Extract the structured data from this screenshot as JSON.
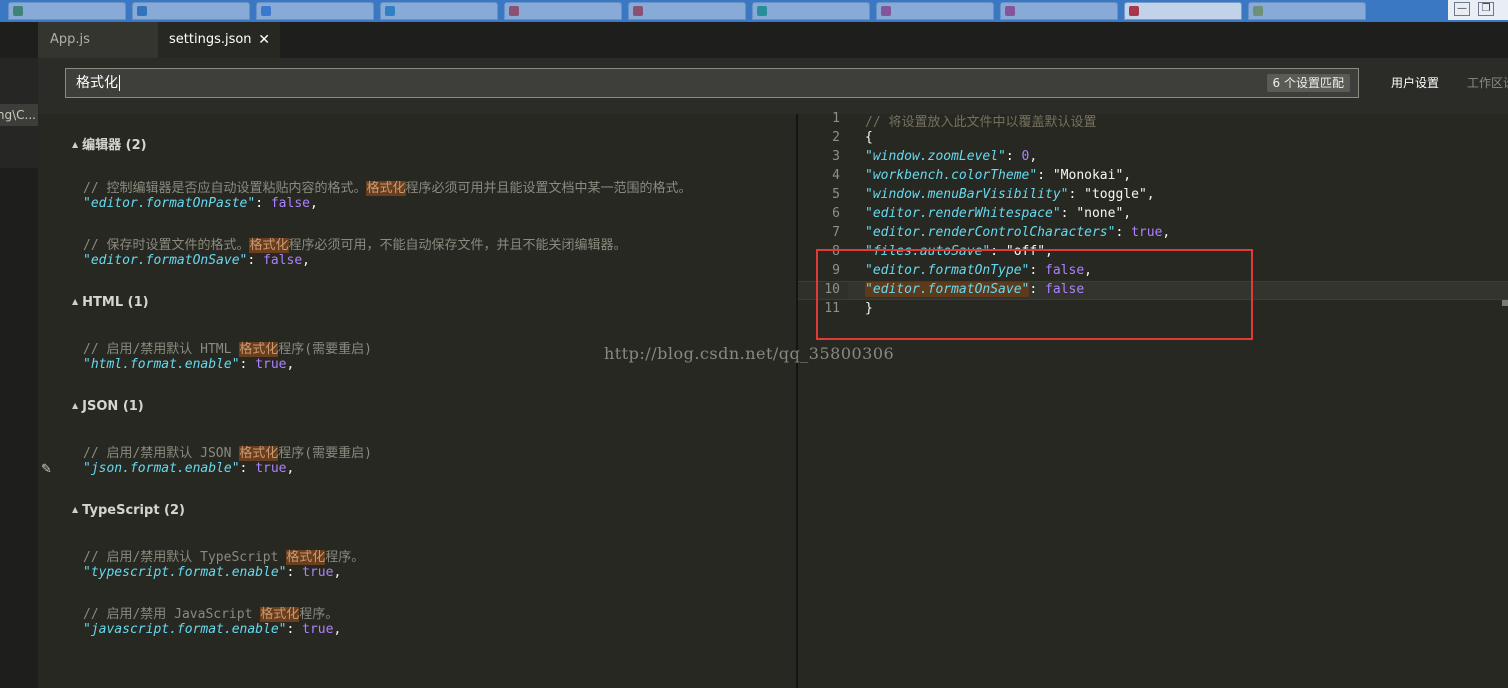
{
  "browser": {
    "tabs": [
      {
        "fav_color": "#4a8c3a"
      },
      {
        "fav_color": "#2e6fb5"
      },
      {
        "fav_color": "#3d7bd9"
      },
      {
        "fav_color": "#2b88c8"
      },
      {
        "fav_color": "#cc3333"
      },
      {
        "fav_color": "#cc3333"
      },
      {
        "fav_color": "#1aa07a"
      },
      {
        "fav_color": "#c23a7a"
      },
      {
        "fav_color": "#c23a7a"
      },
      {
        "fav_color": "#cc2222"
      },
      {
        "fav_color": "#9aa43a"
      }
    ],
    "win_min": "—",
    "win_restore": "❐"
  },
  "left_strip": {
    "path_label": "ing\\C..."
  },
  "editor_tabs": {
    "appjs": "App.js",
    "settings": "settings.json",
    "close_icon": "✕"
  },
  "search": {
    "value": "格式化",
    "placeholder": "",
    "match_count": "6 个设置匹配"
  },
  "settings_tabs": {
    "user": "用户设置",
    "workspace": "工作区设"
  },
  "default_settings": {
    "groups": [
      {
        "title": "编辑器 (2)",
        "items": [
          {
            "comment_pre": "// 控制编辑器是否应自动设置粘贴内容的格式。",
            "comment_hl": "格式化",
            "comment_post": "程序必须可用并且能设置文档中某一范围的格式。",
            "key": "\"editor.formatOnPaste\"",
            "value": "false"
          },
          {
            "comment_pre": "// 保存时设置文件的格式。",
            "comment_hl": "格式化",
            "comment_post": "程序必须可用，不能自动保存文件，并且不能关闭编辑器。",
            "key": "\"editor.formatOnSave\"",
            "value": "false"
          }
        ]
      },
      {
        "title": "HTML (1)",
        "items": [
          {
            "comment_pre": "// 启用/禁用默认 HTML ",
            "comment_hl": "格式化",
            "comment_post": "程序(需要重启)",
            "key": "\"html.format.enable\"",
            "value": "true"
          }
        ]
      },
      {
        "title": "JSON (1)",
        "items": [
          {
            "comment_pre": "// 启用/禁用默认 JSON ",
            "comment_hl": "格式化",
            "comment_post": "程序(需要重启)",
            "key": "\"json.format.enable\"",
            "value": "true"
          }
        ]
      },
      {
        "title": "TypeScript (2)",
        "items": [
          {
            "comment_pre": "// 启用/禁用默认 TypeScript ",
            "comment_hl": "格式化",
            "comment_post": "程序。",
            "key": "\"typescript.format.enable\"",
            "value": "true"
          },
          {
            "comment_pre": "// 启用/禁用 JavaScript ",
            "comment_hl": "格式化",
            "comment_post": "程序。",
            "key": "\"javascript.format.enable\"",
            "value": "true"
          }
        ]
      }
    ],
    "pencil_icon": "✎"
  },
  "user_settings": {
    "lines": [
      {
        "n": "1",
        "comment": "// 将设置放入此文件中以覆盖默认设置"
      },
      {
        "n": "2",
        "text": "{"
      },
      {
        "n": "3",
        "key": "\"window.zoomLevel\"",
        "value": "0",
        "vtype": "num",
        "comma": ","
      },
      {
        "n": "4",
        "key": "\"workbench.colorTheme\"",
        "value": "\"Monokai\"",
        "vtype": "str",
        "comma": ","
      },
      {
        "n": "5",
        "key": "\"window.menuBarVisibility\"",
        "value": "\"toggle\"",
        "vtype": "str",
        "comma": ","
      },
      {
        "n": "6",
        "key": "\"editor.renderWhitespace\"",
        "value": "\"none\"",
        "vtype": "str",
        "comma": ","
      },
      {
        "n": "7",
        "key": "\"editor.renderControlCharacters\"",
        "value": "true",
        "vtype": "bool",
        "comma": ","
      },
      {
        "n": "8",
        "key": "\"files.autoSave\"",
        "value": "\"off\"",
        "vtype": "str",
        "comma": ","
      },
      {
        "n": "9",
        "key": "\"editor.formatOnType\"",
        "value": "false",
        "vtype": "bool",
        "comma": ","
      },
      {
        "n": "10",
        "key": "\"editor.formatOnSave\"",
        "value": "false",
        "vtype": "bool",
        "comma": ""
      },
      {
        "n": "11",
        "text": "}"
      }
    ]
  },
  "watermark": "http://blog.csdn.net/qq_35800306"
}
